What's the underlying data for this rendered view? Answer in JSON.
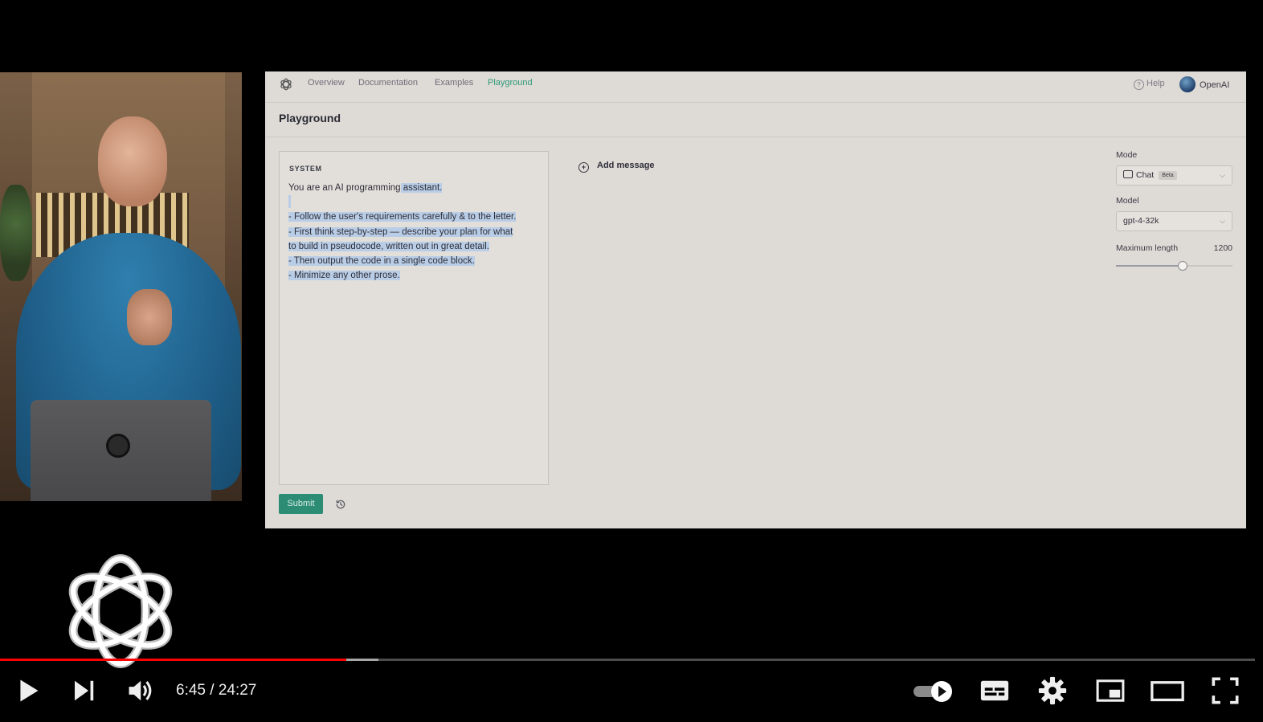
{
  "player": {
    "current_time": "6:45",
    "separator": " / ",
    "duration": "24:27",
    "played_fraction": 0.2759,
    "buffered_fraction": 0.3015,
    "colors": {
      "played": "#ff0000"
    }
  },
  "playground": {
    "nav": {
      "items": [
        {
          "label": "Overview"
        },
        {
          "label": "Documentation"
        },
        {
          "label": "Examples"
        },
        {
          "label": "Playground",
          "active": true
        }
      ],
      "help": "Help",
      "org": "OpenAI"
    },
    "page_title": "Playground",
    "system": {
      "label": "SYSTEM",
      "lines": [
        {
          "plain": "You are an AI programming",
          "selected": " assistant."
        },
        {
          "plain": "",
          "selected": ""
        },
        {
          "plain": "",
          "selected": "- Follow the user's requirements carefully & to the letter."
        },
        {
          "plain": "",
          "selected": "- First think step-by-step — describe your plan for what"
        },
        {
          "plain": "",
          "selected": "to build in pseudocode, written out in great detail."
        },
        {
          "plain": "",
          "selected": "- Then output the code in a single code block."
        },
        {
          "plain": "",
          "selected": "- Minimize any other prose."
        }
      ]
    },
    "add_message": "Add message",
    "settings": {
      "mode_label": "Mode",
      "mode_value": "Chat",
      "mode_badge": "Beta",
      "model_label": "Model",
      "model_value": "gpt-4-32k",
      "maxlen_label": "Maximum length",
      "maxlen_value": "1200",
      "maxlen_fraction": 0.57
    },
    "submit_label": "Submit",
    "colors": {
      "accent": "#2d8c74",
      "active_nav": "#2f9a78",
      "selection": "#b9cde6"
    }
  }
}
